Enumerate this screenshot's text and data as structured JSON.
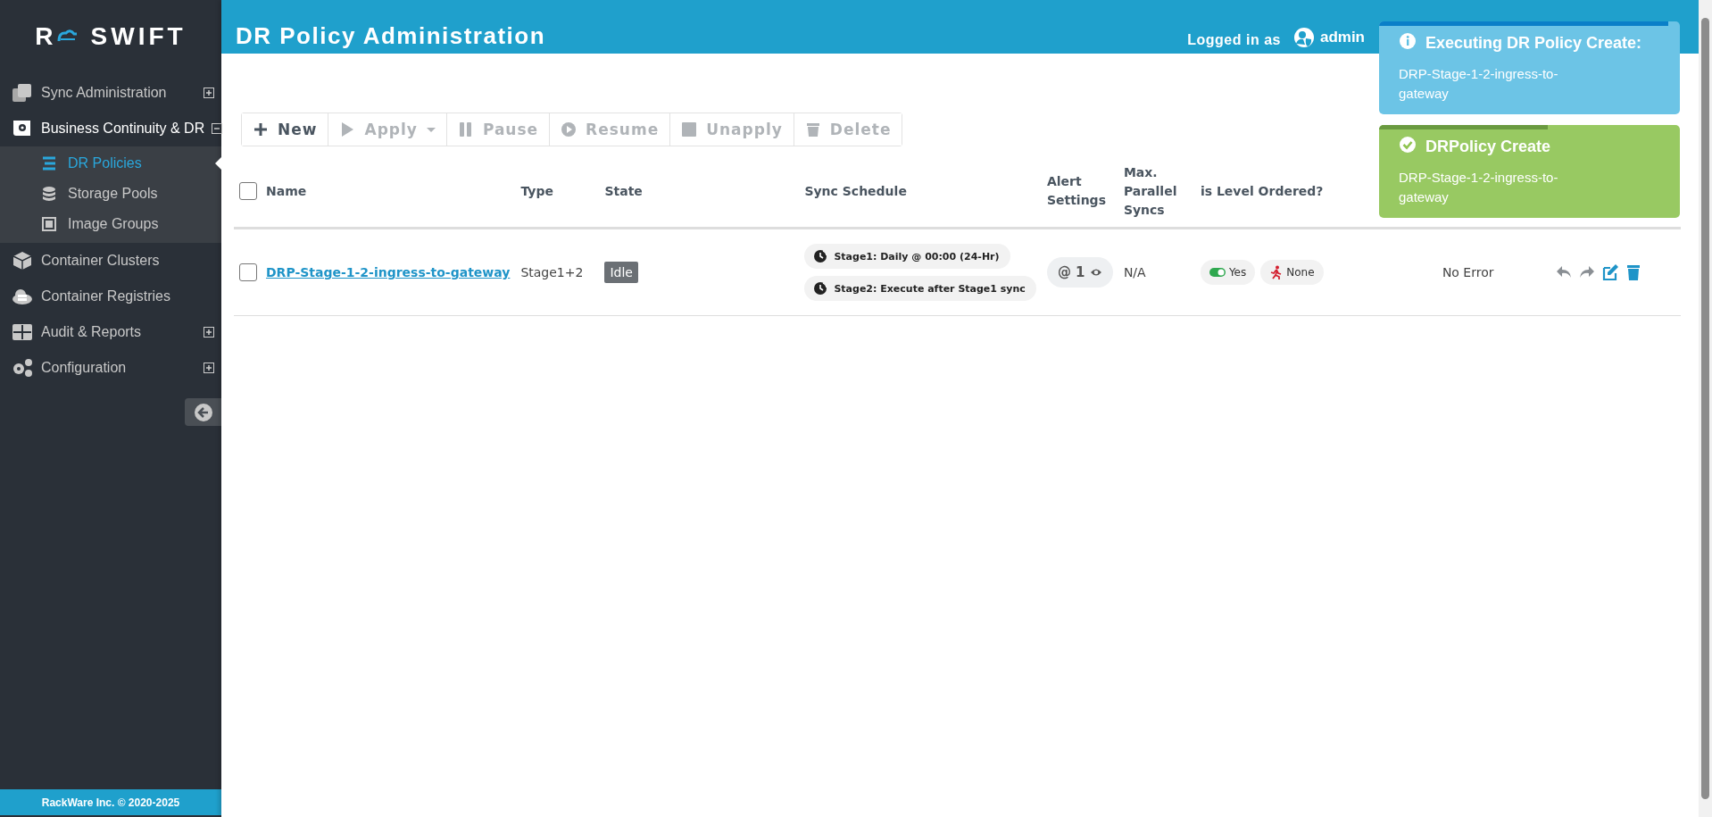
{
  "logo": {
    "letter": "R",
    "name": "SWIFT"
  },
  "sidebar": {
    "items": [
      {
        "label": "Sync Administration",
        "expandable": true,
        "expanded": false,
        "selected": false
      },
      {
        "label": "Business Continuity & DR",
        "expandable": true,
        "expanded": true,
        "selected": false,
        "children": [
          {
            "label": "DR Policies",
            "selected": true
          },
          {
            "label": "Storage Pools",
            "selected": false
          },
          {
            "label": "Image Groups",
            "selected": false
          }
        ]
      },
      {
        "label": "Container Clusters",
        "expandable": false,
        "expanded": false,
        "selected": false
      },
      {
        "label": "Container Registries",
        "expandable": false,
        "expanded": false,
        "selected": false
      },
      {
        "label": "Audit & Reports",
        "expandable": true,
        "expanded": false,
        "selected": false
      },
      {
        "label": "Configuration",
        "expandable": true,
        "expanded": false,
        "selected": false
      }
    ],
    "footer": "RackWare Inc. © 2020-2025"
  },
  "header": {
    "title": "DR Policy Administration",
    "logged_in_label": "Logged in as",
    "user": "admin"
  },
  "toolbar": [
    {
      "label": "New",
      "disabled": false,
      "dropdown": false
    },
    {
      "label": "Apply",
      "disabled": true,
      "dropdown": true
    },
    {
      "label": "Pause",
      "disabled": true,
      "dropdown": false
    },
    {
      "label": "Resume",
      "disabled": true,
      "dropdown": false
    },
    {
      "label": "Unapply",
      "disabled": true,
      "dropdown": false
    },
    {
      "label": "Delete",
      "disabled": true,
      "dropdown": false
    }
  ],
  "table": {
    "select_all": {
      "checked": false
    },
    "columns": [
      "Name",
      "Type",
      "State",
      "Sync Schedule",
      "Alert Settings",
      "Max. Parallel Syncs",
      "is Level Ordered?"
    ],
    "rows": [
      {
        "checked": false,
        "name": "DRP-Stage-1-2-ingress-to-gateway",
        "type": "Stage1+2",
        "state": "Idle",
        "schedules": [
          "Stage1: Daily @ 00:00 (24-Hr)",
          "Stage2: Execute after Stage1 sync"
        ],
        "alert": "@ 1",
        "max_parallel": "N/A",
        "level_ordered": {
          "on": true,
          "label": "Yes"
        },
        "order": "None",
        "last_error": "No Error"
      }
    ]
  },
  "toasts": [
    {
      "kind": "info",
      "title": "Executing DR Policy Create:",
      "message": "DRP-Stage-1-2-ingress-to-gateway",
      "level": 0.96
    },
    {
      "kind": "success",
      "title": "DRPolicy Create",
      "message": "DRP-Stage-1-2-ingress-to-gateway",
      "level": 0.56
    }
  ]
}
